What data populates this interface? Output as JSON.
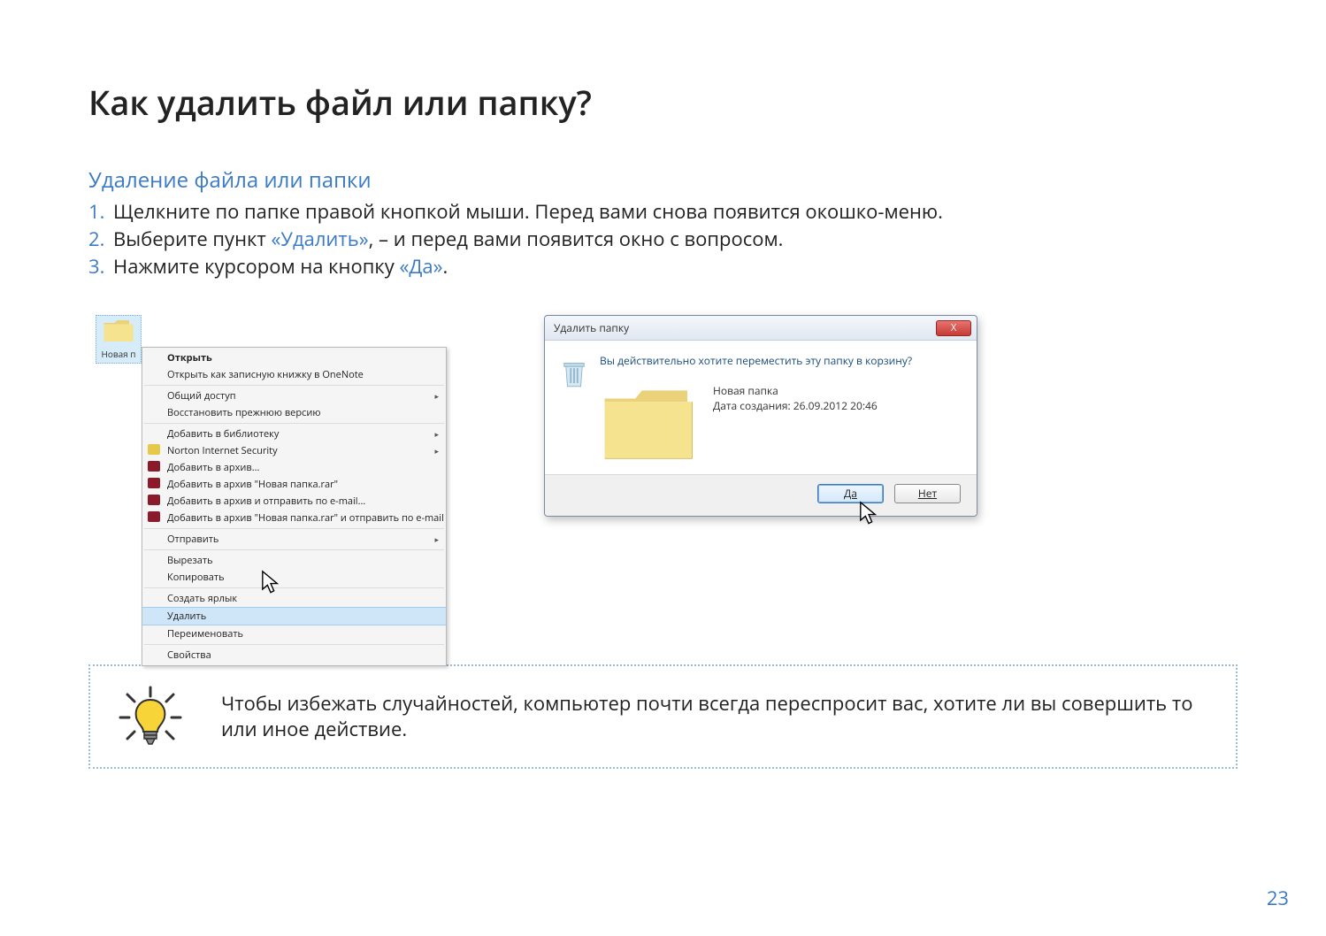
{
  "page_title": "Как удалить файл или папку?",
  "section_title": "Удаление файла или папки",
  "steps": [
    "Щелкните по папке правой кнопкой мыши. Перед вами снова появится окошко-меню.",
    "Выберите пункт «Удалить», – и перед вами появится окно с вопросом.",
    "Нажмите курсором на кнопку «Да»."
  ],
  "step2_term": "«Удалить»",
  "step2_before": "Выберите пункт ",
  "step2_after": ", – и перед вами появится окно с вопросом.",
  "step3_before": "Нажмите курсором на кнопку ",
  "step3_term": "«Да»",
  "step3_after": ".",
  "desktop_folder_label": "Новая п",
  "context_menu": {
    "open": "Открыть",
    "open_onenote": "Открыть как записную книжку в OneNote",
    "share": "Общий доступ",
    "restore": "Восстановить прежнюю версию",
    "add_lib": "Добавить в библиотеку",
    "norton": "Norton Internet Security",
    "add_arch": "Добавить в архив...",
    "add_arch_name": "Добавить в архив \"Новая папка.rar\"",
    "add_arch_email": "Добавить в архив и отправить по e-mail...",
    "add_arch_name_email": "Добавить в архив \"Новая папка.rar\" и отправить по e-mail",
    "send": "Отправить",
    "cut": "Вырезать",
    "copy": "Копировать",
    "shortcut": "Создать ярлык",
    "delete": "Удалить",
    "rename": "Переименовать",
    "props": "Свойства"
  },
  "dialog": {
    "title": "Удалить папку",
    "close": "X",
    "question": "Вы действительно хотите переместить эту папку в корзину?",
    "folder_name": "Новая папка",
    "date_label": "Дата создания: 26.09.2012 20:46",
    "yes": "Да",
    "no": "Нет"
  },
  "tip": "Чтобы избежать случайностей, компьютер почти всегда переспросит вас, хотите ли вы совершить то или иное действие.",
  "page_number": "23"
}
